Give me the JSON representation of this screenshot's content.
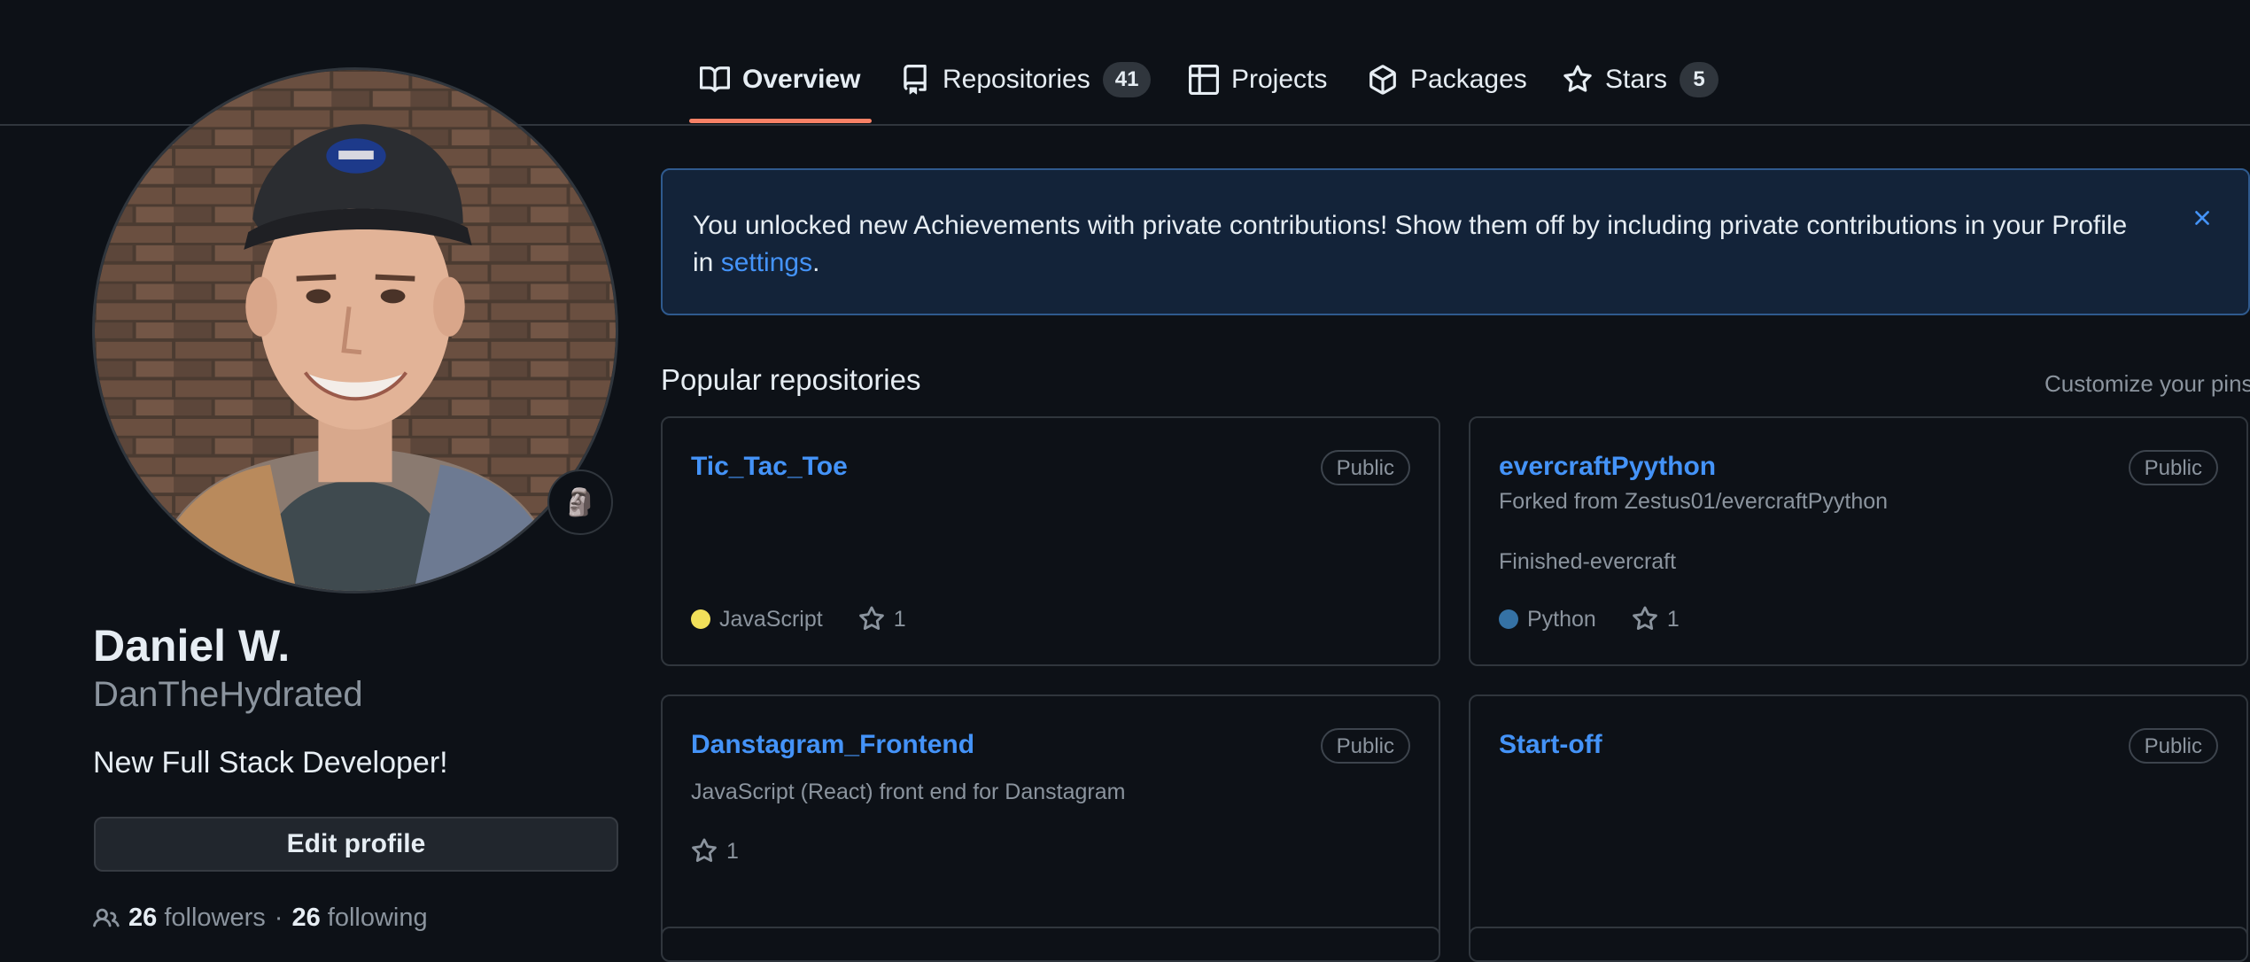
{
  "nav": {
    "tabs": [
      {
        "label": "Overview",
        "icon": "book-icon"
      },
      {
        "label": "Repositories",
        "icon": "repo-icon",
        "count": "41"
      },
      {
        "label": "Projects",
        "icon": "table-icon"
      },
      {
        "label": "Packages",
        "icon": "package-icon"
      },
      {
        "label": "Stars",
        "icon": "star-icon",
        "count": "5"
      }
    ]
  },
  "profile": {
    "name": "Daniel W.",
    "login": "DanTheHydrated",
    "bio": "New Full Stack Developer!",
    "edit_label": "Edit profile",
    "followers_count": "26",
    "followers_label": "followers",
    "separator": "·",
    "following_count": "26",
    "following_label": "following",
    "status_emoji": "🗿"
  },
  "banner": {
    "text": "You unlocked new Achievements with private contributions! Show them off by including private contributions in your Profile in ",
    "link": "settings",
    "end": "."
  },
  "popular": {
    "title": "Popular repositories",
    "customize": "Customize your pins",
    "repos": [
      {
        "name": "Tic_Tac_Toe",
        "visibility": "Public",
        "language": "JavaScript",
        "lang_color": "#f1e05a",
        "stars": "1"
      },
      {
        "name": "evercraftPyython",
        "visibility": "Public",
        "forked_from": "Forked from Zestus01/evercraftPyython",
        "description": "Finished-evercraft",
        "language": "Python",
        "lang_color": "#3572A5",
        "stars": "1"
      },
      {
        "name": "Danstagram_Frontend",
        "visibility": "Public",
        "description": "JavaScript (React) front end for Danstagram",
        "stars": "1"
      },
      {
        "name": "Start-off",
        "visibility": "Public"
      }
    ]
  },
  "colors": {
    "accent": "#f78166",
    "link": "#4493f8",
    "background": "#0d1117",
    "border": "#30363d"
  }
}
